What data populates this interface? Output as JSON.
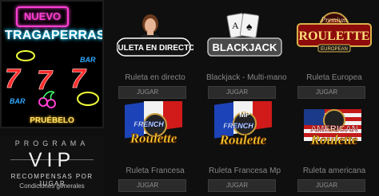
{
  "promo": {
    "badge": "NUEVO",
    "title": "TRAGAPERRAS",
    "cta": "PRUÉBELO",
    "slot_symbols": [
      "7",
      "7",
      "7"
    ],
    "bar_text": "BAR",
    "colors": {
      "pink": "#ff3fd2",
      "cyan": "#2ee0ff",
      "red": "#ff2a2a",
      "yellow": "#ffe46b"
    }
  },
  "vip": {
    "program": "PROGRAMA",
    "title": "VIP",
    "tagline": "RECOMPENSAS POR JUGAR",
    "conditions": "Condiciones generales"
  },
  "games": [
    {
      "name": "Ruleta en directo",
      "logo": "RULETA EN DIRECTO",
      "button": "JUGAR",
      "icon": "live-dealer-icon"
    },
    {
      "name": "Blackjack - Multi-mano",
      "logo": "BLACKJACK",
      "button": "JUGAR",
      "icon": "cards-icon"
    },
    {
      "name": "Ruleta Europea",
      "logo_top": "Premium",
      "logo": "ROULETTE",
      "logo_sub": "EUROPEAN",
      "button": "JUGAR",
      "icon": "roulette-wheel-icon"
    },
    {
      "name": "Ruleta Francesa",
      "logo_top": "FRENCH",
      "logo": "Roulette",
      "button": "JUGAR",
      "icon": "roulette-wheel-icon"
    },
    {
      "name": "Ruleta Francesa Mp",
      "logo_top": "FRENCH",
      "logo_badge": "MP",
      "logo": "Roulette",
      "button": "JUGAR",
      "icon": "roulette-wheel-icon"
    },
    {
      "name": "Ruleta americana",
      "logo_top": "AMERICAN",
      "logo": "Roulette",
      "button": "JUGAR",
      "icon": "roulette-wheel-icon"
    }
  ]
}
